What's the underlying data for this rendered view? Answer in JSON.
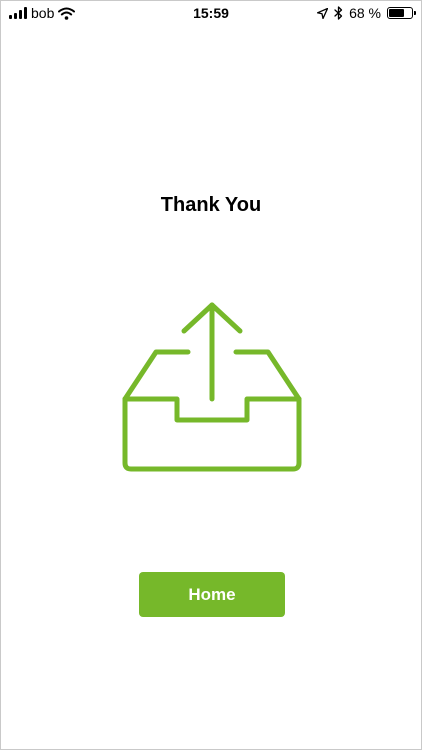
{
  "status_bar": {
    "carrier": "bob",
    "time": "15:59",
    "battery_text": "68 %",
    "battery_level": 0.68,
    "icons": [
      "signal-icon",
      "wifi-icon",
      "location-icon",
      "bluetooth-icon",
      "battery-icon"
    ]
  },
  "main": {
    "title": "Thank You",
    "illustration_icon": "tray-upload-icon",
    "home_button_label": "Home"
  },
  "colors": {
    "accent": "#76b82a",
    "text": "#000000",
    "background": "#ffffff"
  }
}
